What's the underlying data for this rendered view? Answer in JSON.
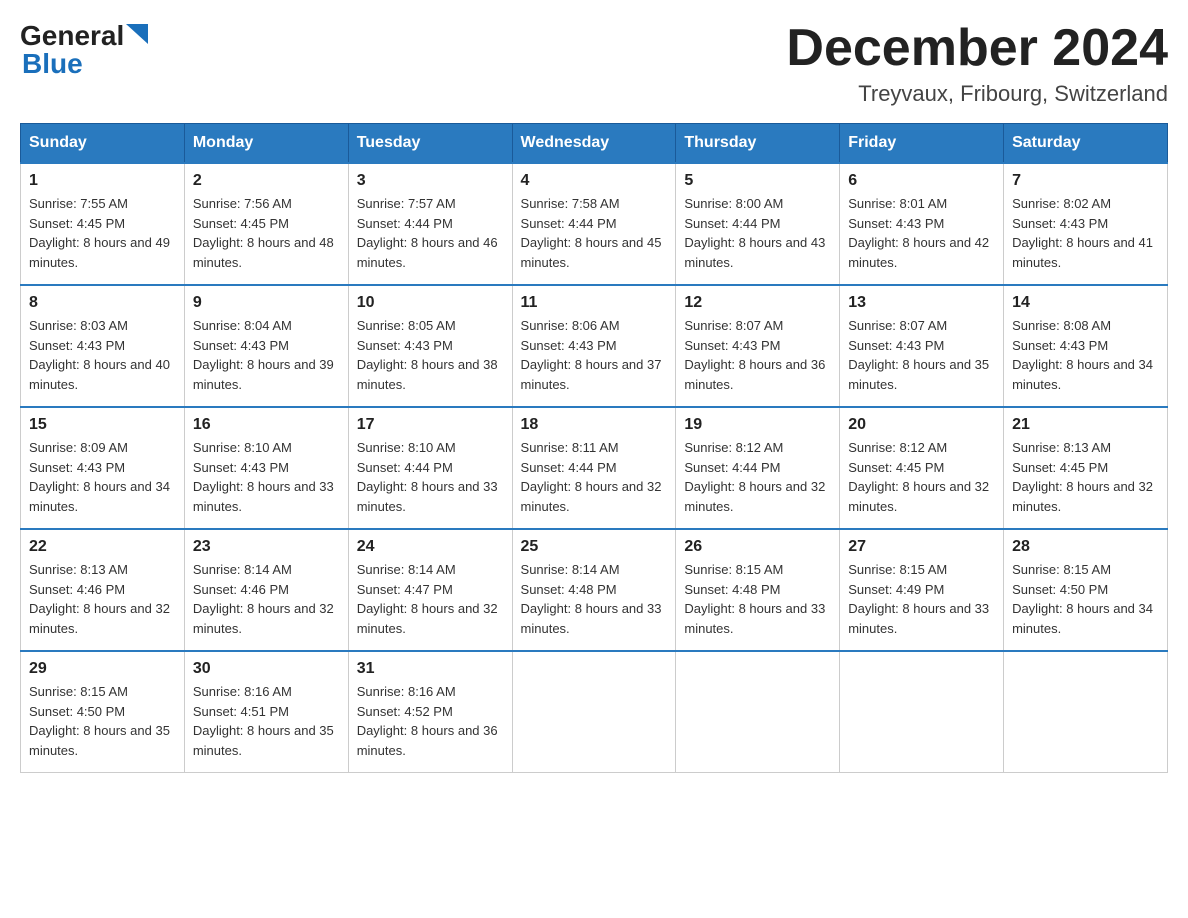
{
  "header": {
    "logo_general": "General",
    "logo_blue": "Blue",
    "month_title": "December 2024",
    "location": "Treyvaux, Fribourg, Switzerland"
  },
  "weekdays": [
    "Sunday",
    "Monday",
    "Tuesday",
    "Wednesday",
    "Thursday",
    "Friday",
    "Saturday"
  ],
  "weeks": [
    [
      {
        "day": "1",
        "sunrise": "7:55 AM",
        "sunset": "4:45 PM",
        "daylight": "8 hours and 49 minutes."
      },
      {
        "day": "2",
        "sunrise": "7:56 AM",
        "sunset": "4:45 PM",
        "daylight": "8 hours and 48 minutes."
      },
      {
        "day": "3",
        "sunrise": "7:57 AM",
        "sunset": "4:44 PM",
        "daylight": "8 hours and 46 minutes."
      },
      {
        "day": "4",
        "sunrise": "7:58 AM",
        "sunset": "4:44 PM",
        "daylight": "8 hours and 45 minutes."
      },
      {
        "day": "5",
        "sunrise": "8:00 AM",
        "sunset": "4:44 PM",
        "daylight": "8 hours and 43 minutes."
      },
      {
        "day": "6",
        "sunrise": "8:01 AM",
        "sunset": "4:43 PM",
        "daylight": "8 hours and 42 minutes."
      },
      {
        "day": "7",
        "sunrise": "8:02 AM",
        "sunset": "4:43 PM",
        "daylight": "8 hours and 41 minutes."
      }
    ],
    [
      {
        "day": "8",
        "sunrise": "8:03 AM",
        "sunset": "4:43 PM",
        "daylight": "8 hours and 40 minutes."
      },
      {
        "day": "9",
        "sunrise": "8:04 AM",
        "sunset": "4:43 PM",
        "daylight": "8 hours and 39 minutes."
      },
      {
        "day": "10",
        "sunrise": "8:05 AM",
        "sunset": "4:43 PM",
        "daylight": "8 hours and 38 minutes."
      },
      {
        "day": "11",
        "sunrise": "8:06 AM",
        "sunset": "4:43 PM",
        "daylight": "8 hours and 37 minutes."
      },
      {
        "day": "12",
        "sunrise": "8:07 AM",
        "sunset": "4:43 PM",
        "daylight": "8 hours and 36 minutes."
      },
      {
        "day": "13",
        "sunrise": "8:07 AM",
        "sunset": "4:43 PM",
        "daylight": "8 hours and 35 minutes."
      },
      {
        "day": "14",
        "sunrise": "8:08 AM",
        "sunset": "4:43 PM",
        "daylight": "8 hours and 34 minutes."
      }
    ],
    [
      {
        "day": "15",
        "sunrise": "8:09 AM",
        "sunset": "4:43 PM",
        "daylight": "8 hours and 34 minutes."
      },
      {
        "day": "16",
        "sunrise": "8:10 AM",
        "sunset": "4:43 PM",
        "daylight": "8 hours and 33 minutes."
      },
      {
        "day": "17",
        "sunrise": "8:10 AM",
        "sunset": "4:44 PM",
        "daylight": "8 hours and 33 minutes."
      },
      {
        "day": "18",
        "sunrise": "8:11 AM",
        "sunset": "4:44 PM",
        "daylight": "8 hours and 32 minutes."
      },
      {
        "day": "19",
        "sunrise": "8:12 AM",
        "sunset": "4:44 PM",
        "daylight": "8 hours and 32 minutes."
      },
      {
        "day": "20",
        "sunrise": "8:12 AM",
        "sunset": "4:45 PM",
        "daylight": "8 hours and 32 minutes."
      },
      {
        "day": "21",
        "sunrise": "8:13 AM",
        "sunset": "4:45 PM",
        "daylight": "8 hours and 32 minutes."
      }
    ],
    [
      {
        "day": "22",
        "sunrise": "8:13 AM",
        "sunset": "4:46 PM",
        "daylight": "8 hours and 32 minutes."
      },
      {
        "day": "23",
        "sunrise": "8:14 AM",
        "sunset": "4:46 PM",
        "daylight": "8 hours and 32 minutes."
      },
      {
        "day": "24",
        "sunrise": "8:14 AM",
        "sunset": "4:47 PM",
        "daylight": "8 hours and 32 minutes."
      },
      {
        "day": "25",
        "sunrise": "8:14 AM",
        "sunset": "4:48 PM",
        "daylight": "8 hours and 33 minutes."
      },
      {
        "day": "26",
        "sunrise": "8:15 AM",
        "sunset": "4:48 PM",
        "daylight": "8 hours and 33 minutes."
      },
      {
        "day": "27",
        "sunrise": "8:15 AM",
        "sunset": "4:49 PM",
        "daylight": "8 hours and 33 minutes."
      },
      {
        "day": "28",
        "sunrise": "8:15 AM",
        "sunset": "4:50 PM",
        "daylight": "8 hours and 34 minutes."
      }
    ],
    [
      {
        "day": "29",
        "sunrise": "8:15 AM",
        "sunset": "4:50 PM",
        "daylight": "8 hours and 35 minutes."
      },
      {
        "day": "30",
        "sunrise": "8:16 AM",
        "sunset": "4:51 PM",
        "daylight": "8 hours and 35 minutes."
      },
      {
        "day": "31",
        "sunrise": "8:16 AM",
        "sunset": "4:52 PM",
        "daylight": "8 hours and 36 minutes."
      },
      null,
      null,
      null,
      null
    ]
  ]
}
